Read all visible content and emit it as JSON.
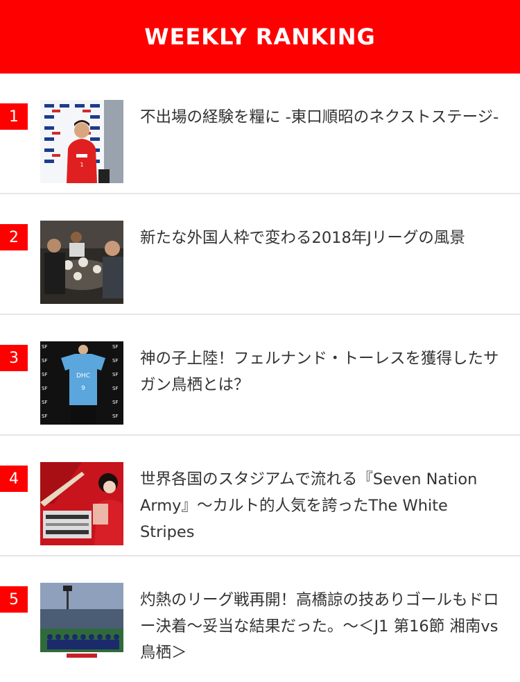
{
  "theme": {
    "accent": "#ff0000"
  },
  "header": {
    "title": "WEEKLY RANKING"
  },
  "ranking": [
    {
      "rank": "1",
      "title": "不出場の経験を糧に -東口順昭のネクストステージ-",
      "image_alt": "Player in red jersey in front of sponsor backdrop"
    },
    {
      "rank": "2",
      "title": "新たな外国人枠で変わる2018年Jリーグの風景",
      "image_alt": "Group of men seated at a dinner table"
    },
    {
      "rank": "3",
      "title": "神の子上陸！フェルナンド・トーレスを獲得したサガン鳥栖とは？",
      "image_alt": "Player holding a blue DHC jersey"
    },
    {
      "rank": "4",
      "title": "世界各国のスタジアムで流れる『Seven Nation Army』〜カルト的人気を誇ったThe White Stripes",
      "image_alt": "Band members posing on a red background"
    },
    {
      "rank": "5",
      "title": "灼熱のリーグ戦再開！高橋諒の技ありゴールもドロー決着〜妥当な結果だった。〜＜J1 第16節 湘南vs鳥栖＞",
      "image_alt": "Team lined up for photo in stadium"
    }
  ]
}
